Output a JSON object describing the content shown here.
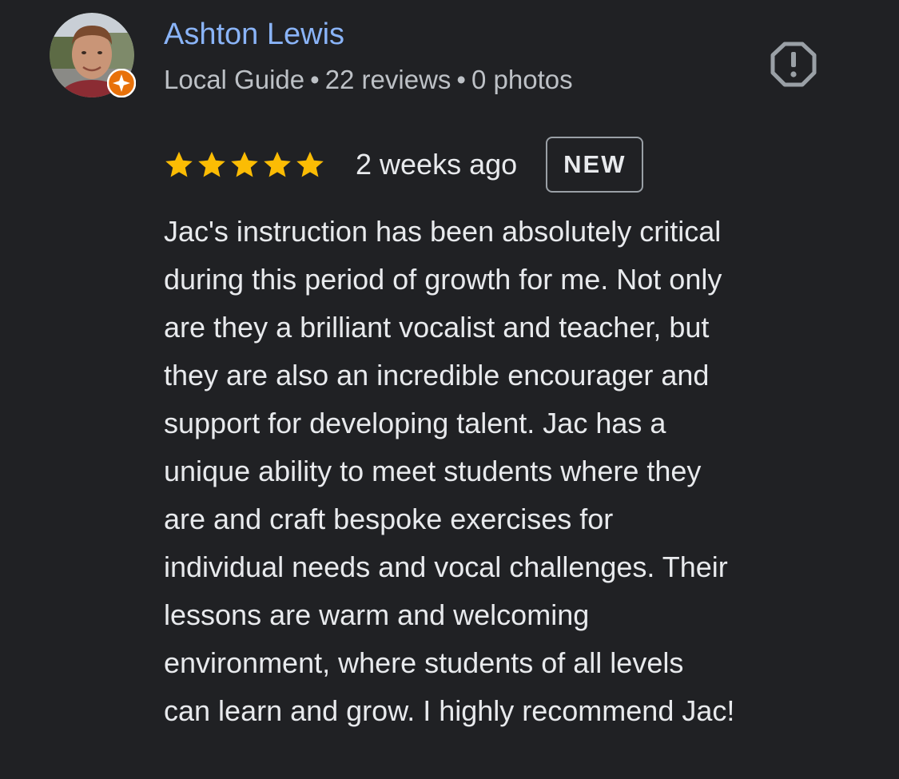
{
  "reviewer": {
    "name": "Ashton Lewis",
    "level": "Local Guide",
    "separator": "•",
    "reviews": "22 reviews",
    "photos": "0 photos"
  },
  "review": {
    "rating": 5,
    "rating_max": 5,
    "date": "2 weeks ago",
    "badge": "NEW",
    "lines": [
      "Jac's instruction has been absolutely critical",
      "during this period of growth for me. Not only",
      "are they a brilliant vocalist and teacher, but",
      "they are also an incredible encourager and",
      "support for developing talent. Jac has a",
      "unique ability to meet students where they",
      "are and craft bespoke exercises for",
      "individual needs and vocal challenges. Their",
      "lessons are warm and welcoming",
      "environment, where students of all levels",
      "can learn and grow. I highly recommend Jac!"
    ]
  },
  "icons": {
    "report": "report-flag-icon",
    "star": "star-icon",
    "guide_badge": "local-guide-badge-icon"
  },
  "colors": {
    "background": "#202124",
    "name": "#8ab4f8",
    "meta": "#bdc1c6",
    "text": "#e8eaed",
    "star": "#fbbc04",
    "badge_border": "#9aa0a6",
    "guide_badge": "#e8710a"
  }
}
